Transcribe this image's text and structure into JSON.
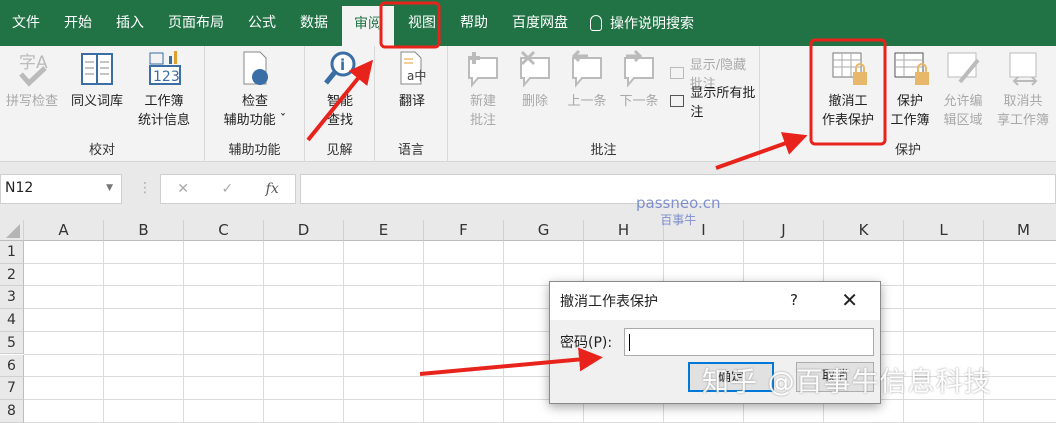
{
  "tabs": [
    "文件",
    "开始",
    "插入",
    "页面布局",
    "公式",
    "数据",
    "审阅",
    "视图",
    "帮助",
    "百度网盘"
  ],
  "active_tab": "审阅",
  "tell_me": "操作说明搜索",
  "ribbon": {
    "proofing": {
      "label": "校对",
      "spell": "拼写检查",
      "thesaurus": "同义词库",
      "stats1": "工作簿",
      "stats2": "统计信息"
    },
    "accessibility": {
      "label": "辅助功能",
      "check1": "检查",
      "check2": "辅助功能 ˇ"
    },
    "insights": {
      "label": "见解",
      "smart1": "智能",
      "smart2": "查找"
    },
    "language": {
      "label": "语言",
      "translate": "翻译"
    },
    "comments": {
      "label": "批注",
      "new1": "新建",
      "new2": "批注",
      "delete": "删除",
      "prev": "上一条",
      "next": "下一条",
      "show_hide": "显示/隐藏批注",
      "show_all": "显示所有批注"
    },
    "protect": {
      "label": "保护",
      "unprotect1": "撤消工",
      "unprotect2": "作表保护",
      "wb1": "保护",
      "wb2": "工作簿",
      "allow1": "允许编",
      "allow2": "辑区域",
      "unshare1": "取消共",
      "unshare2": "享工作簿"
    }
  },
  "formula_bar": {
    "name_box": "N12",
    "cancel": "✕",
    "enter": "✓",
    "fx": "fx",
    "value": ""
  },
  "columns": [
    "A",
    "B",
    "C",
    "D",
    "E",
    "F",
    "G",
    "H",
    "I",
    "J",
    "K",
    "L",
    "M"
  ],
  "rows": [
    "1",
    "2",
    "3",
    "4",
    "5",
    "6",
    "7",
    "8"
  ],
  "dialog": {
    "title": "撤消工作表保护",
    "help": "?",
    "close": "✕",
    "password_label": "密码(P):",
    "password_value": "",
    "ok": "确定",
    "cancel": "取消"
  },
  "watermarks": {
    "site": "passneo.cn",
    "site_sub": "百事牛",
    "zhihu": "知乎 @百事牛信息科技"
  },
  "colors": {
    "excel_green": "#217346",
    "annotation_red": "#e8231c",
    "dialog_focus": "#0078d7"
  }
}
